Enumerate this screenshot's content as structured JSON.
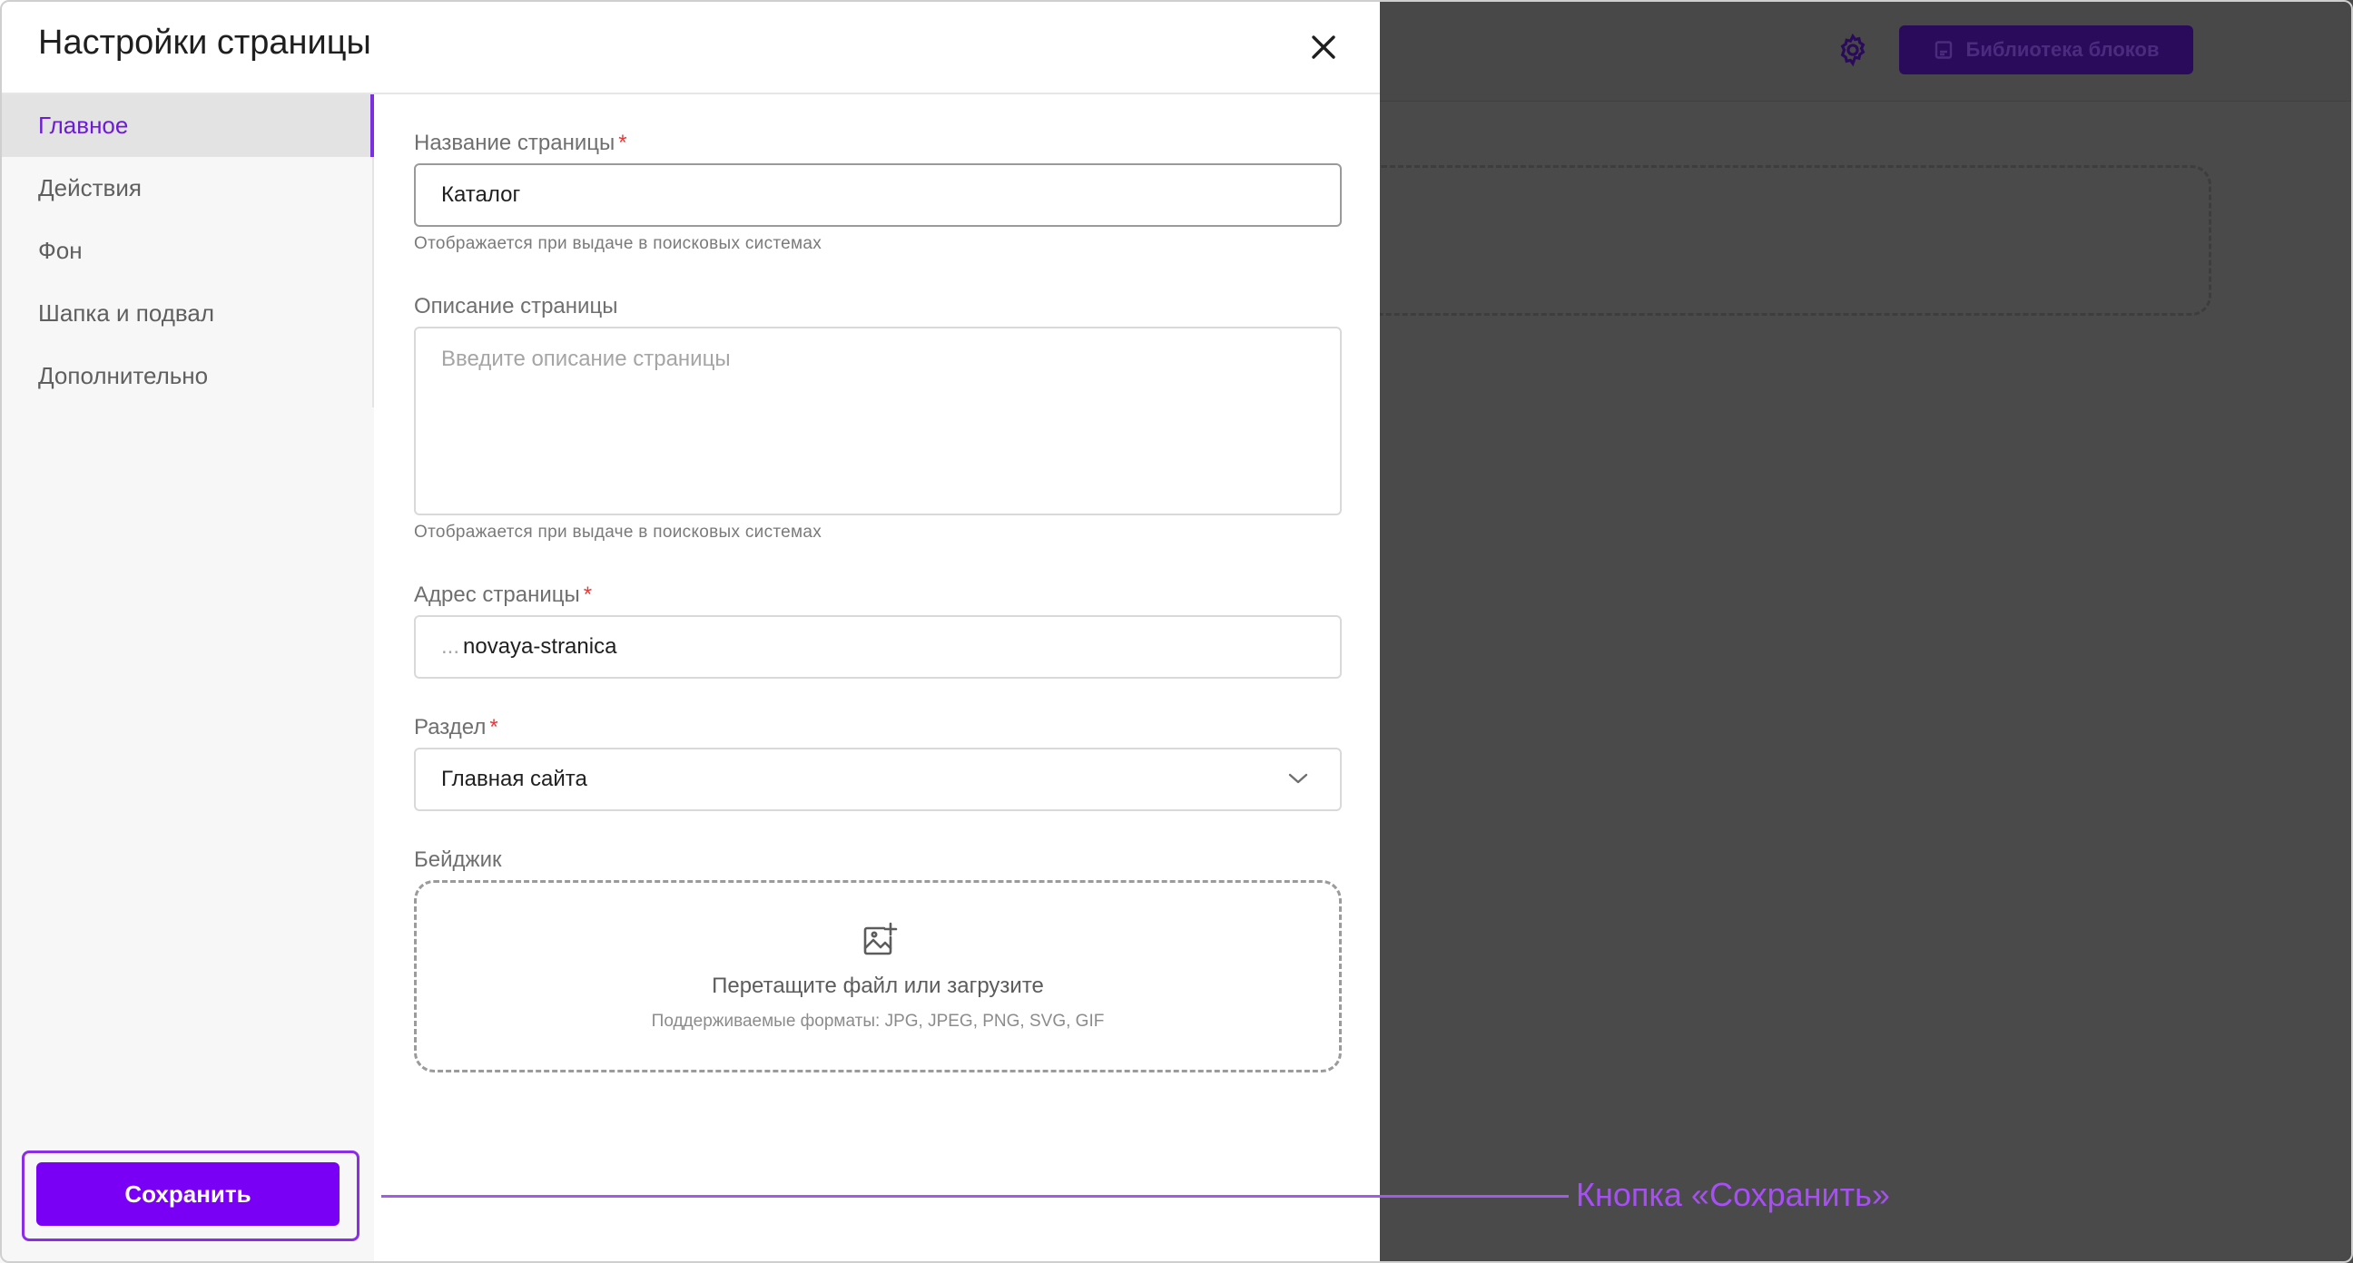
{
  "modal": {
    "title": "Настройки страницы",
    "close_icon": "close-icon"
  },
  "sidebar": {
    "items": [
      {
        "label": "Главное",
        "active": true
      },
      {
        "label": "Действия",
        "active": false
      },
      {
        "label": "Фон",
        "active": false
      },
      {
        "label": "Шапка и подвал",
        "active": false
      },
      {
        "label": "Дополнительно",
        "active": false
      }
    ],
    "save_label": "Сохранить"
  },
  "form": {
    "page_name": {
      "label": "Название страницы",
      "required_mark": "*",
      "value": "Каталог",
      "hint": "Отображается при выдаче в поисковых системах"
    },
    "page_description": {
      "label": "Описание страницы",
      "placeholder": "Введите описание страницы",
      "hint": "Отображается при выдаче в поисковых системах"
    },
    "page_address": {
      "label": "Адрес страницы",
      "required_mark": "*",
      "prefix": "...",
      "value": "novaya-stranica"
    },
    "section": {
      "label": "Раздел",
      "required_mark": "*",
      "selected": "Главная сайта"
    },
    "badge": {
      "label": "Бейджик",
      "upload_title": "Перетащите файл или загрузите",
      "formats": "Поддерживаемые форматы: JPG, JPEG, PNG, SVG, GIF"
    }
  },
  "editor": {
    "library_button": "Библиотека блоков",
    "settings_icon": "gear-icon"
  },
  "annotation": {
    "text": "Кнопка «Сохранить»"
  },
  "colors": {
    "accent": "#7a00f5",
    "active_nav_text": "#6d1bd6",
    "annotation": "#a74ef5",
    "required": "#e23b3b",
    "backdrop": "#4a4a4a"
  }
}
